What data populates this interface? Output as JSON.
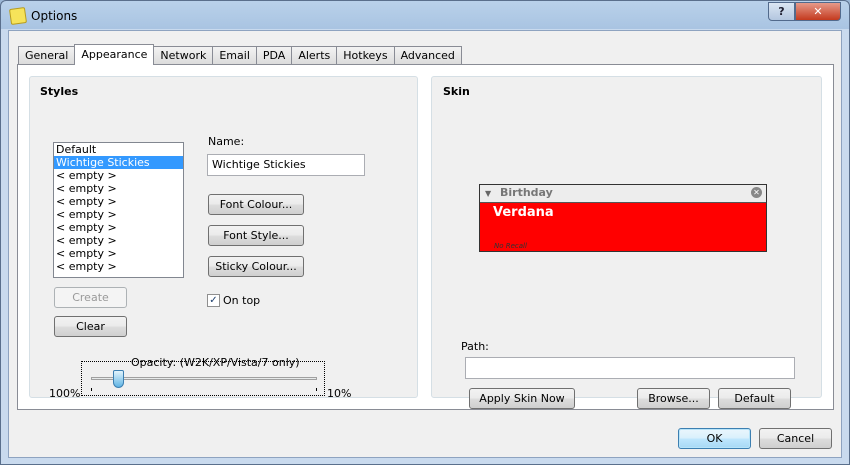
{
  "window": {
    "title": "Options",
    "help_symbol": "?",
    "close_symbol": "✕"
  },
  "tabs": [
    {
      "label": "General",
      "active": false
    },
    {
      "label": "Appearance",
      "active": true
    },
    {
      "label": "Network",
      "active": false
    },
    {
      "label": "Email",
      "active": false
    },
    {
      "label": "PDA",
      "active": false
    },
    {
      "label": "Alerts",
      "active": false
    },
    {
      "label": "Hotkeys",
      "active": false
    },
    {
      "label": "Advanced",
      "active": false
    }
  ],
  "styles": {
    "title": "Styles",
    "items": [
      "Default",
      "Wichtige Stickies",
      "< empty >",
      "< empty >",
      "< empty >",
      "< empty >",
      "< empty >",
      "< empty >",
      "< empty >",
      "< empty >"
    ],
    "selected_index": 1,
    "name_label": "Name:",
    "name_value": "Wichtige Stickies",
    "font_colour": "Font Colour...",
    "font_style": "Font Style...",
    "sticky_colour": "Sticky Colour...",
    "on_top_label": "On top",
    "on_top_checked": true,
    "check_mark": "✓",
    "create": "Create",
    "clear": "Clear",
    "opacity_label": "Opacity:  (W2K/XP/Vista/7 only)",
    "opacity_min": "100%",
    "opacity_max": "10%",
    "opacity_position": 0.1
  },
  "skin": {
    "title": "Skin",
    "preview_title": "Birthday",
    "preview_font": "Verdana",
    "preview_footer": "No Recall",
    "preview_bg": "#ff0000",
    "path_label": "Path:",
    "path_value": "",
    "apply": "Apply Skin Now",
    "browse": "Browse...",
    "default": "Default"
  },
  "dialog": {
    "ok": "OK",
    "cancel": "Cancel"
  }
}
